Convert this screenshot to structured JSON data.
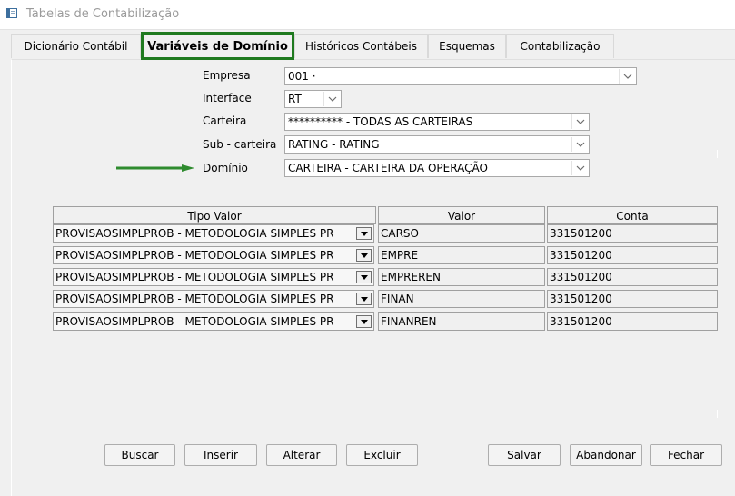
{
  "window": {
    "title": "Tabelas de Contabilização"
  },
  "tabs": [
    {
      "label": "Dicionário Contábil"
    },
    {
      "label": "Variáveis de Domínio"
    },
    {
      "label": "Históricos Contábeis"
    },
    {
      "label": "Esquemas"
    },
    {
      "label": "Contabilização"
    }
  ],
  "active_tab": "Variáveis de Domínio",
  "form": {
    "empresa": {
      "label": "Empresa",
      "value": "001 ·"
    },
    "interface": {
      "label": "Interface",
      "value": "RT"
    },
    "carteira": {
      "label": "Carteira",
      "value": "********** - TODAS AS CARTEIRAS"
    },
    "subcarteira": {
      "label": "Sub - carteira",
      "value": "RATING - RATING"
    },
    "dominio": {
      "label": "Domínio",
      "value": "CARTEIRA - CARTEIRA DA OPERAÇÃO"
    }
  },
  "grid": {
    "headers": [
      "Tipo Valor",
      "Valor",
      "Conta"
    ],
    "rows": [
      {
        "tipo": "PROVISAOSIMPLPROB - METODOLOGIA SIMPLES PR",
        "valor": "CARSO",
        "conta": "331501200"
      },
      {
        "tipo": "PROVISAOSIMPLPROB - METODOLOGIA SIMPLES PR",
        "valor": "EMPRE",
        "conta": "331501200"
      },
      {
        "tipo": "PROVISAOSIMPLPROB - METODOLOGIA SIMPLES PR",
        "valor": "EMPREREN",
        "conta": "331501200"
      },
      {
        "tipo": "PROVISAOSIMPLPROB - METODOLOGIA SIMPLES PR",
        "valor": "FINAN",
        "conta": "331501200"
      },
      {
        "tipo": "PROVISAOSIMPLPROB - METODOLOGIA SIMPLES PR",
        "valor": "FINANREN",
        "conta": "331501200"
      }
    ]
  },
  "buttons": {
    "buscar": "Buscar",
    "inserir": "Inserir",
    "alterar": "Alterar",
    "excluir": "Excluir",
    "salvar": "Salvar",
    "abandonar": "Abandonar",
    "fechar": "Fechar"
  },
  "colors": {
    "highlight": "#1f7a1f",
    "arrow": "#2e8b2e"
  }
}
